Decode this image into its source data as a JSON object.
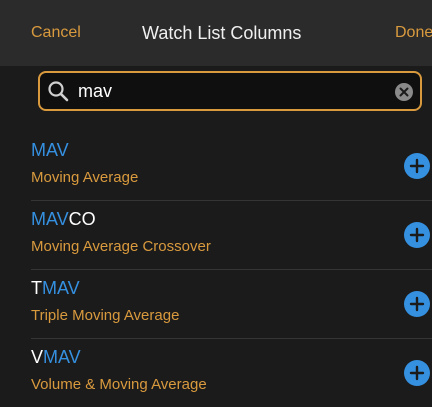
{
  "nav": {
    "cancel_label": "Cancel",
    "title": "Watch List Columns",
    "done_label": "Done"
  },
  "search": {
    "value": "mav",
    "placeholder": ""
  },
  "results": [
    {
      "highlight": "MAV",
      "rest": "",
      "description": "Moving Average"
    },
    {
      "highlight": "MAV",
      "rest": "CO",
      "description": "Moving Average Crossover"
    },
    {
      "prefix": "T",
      "highlight": "MAV",
      "rest": "",
      "description": "Triple Moving Average"
    },
    {
      "prefix": "V",
      "highlight": "MAV",
      "rest": "",
      "description": "Volume & Moving Average"
    }
  ],
  "icons": {
    "search": "search-icon",
    "clear": "clear-icon",
    "add": "add-icon"
  },
  "colors": {
    "accent": "#d99a3e",
    "match_highlight": "#3590e0",
    "add_button": "#3590e0",
    "background": "#1b1b1b",
    "nav_background": "#2b2b2b"
  }
}
